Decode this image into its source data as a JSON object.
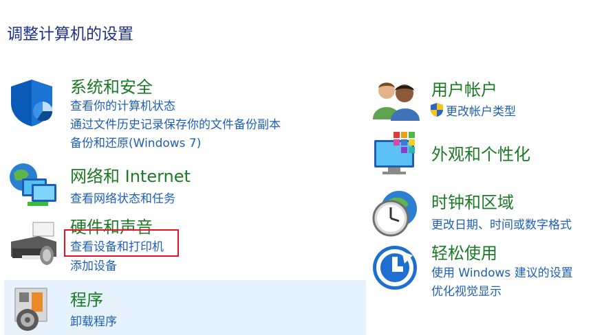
{
  "page": {
    "title": "调整计算机的设置"
  },
  "left": [
    {
      "title": "系统和安全",
      "icon": "security-shield-icon",
      "links": [
        "查看你的计算机状态",
        "通过文件历史记录保存你的文件备份副本",
        "备份和还原(Windows 7)"
      ]
    },
    {
      "title": "网络和 Internet",
      "icon": "network-icon",
      "links": [
        "查看网络状态和任务"
      ]
    },
    {
      "title": "硬件和声音",
      "icon": "printer-icon",
      "links": [
        "查看设备和打印机",
        "添加设备"
      ]
    },
    {
      "title": "程序",
      "icon": "programs-icon",
      "links": [
        "卸载程序"
      ]
    }
  ],
  "right": [
    {
      "title": "用户帐户",
      "icon": "users-icon",
      "links": [
        "更改帐户类型"
      ]
    },
    {
      "title": "外观和个性化",
      "icon": "appearance-icon",
      "links": []
    },
    {
      "title": "时钟和区域",
      "icon": "clock-globe-icon",
      "links": [
        "更改日期、时间或数字格式"
      ]
    },
    {
      "title": "轻松使用",
      "icon": "ease-of-access-icon",
      "links": [
        "使用 Windows 建议的设置",
        "优化视觉显示"
      ]
    }
  ],
  "colors": {
    "title": "#1e3287",
    "category": "#1a7a26",
    "link": "#1d5fb8",
    "highlight": "#e5f1fb",
    "annotation": "#e81123"
  }
}
